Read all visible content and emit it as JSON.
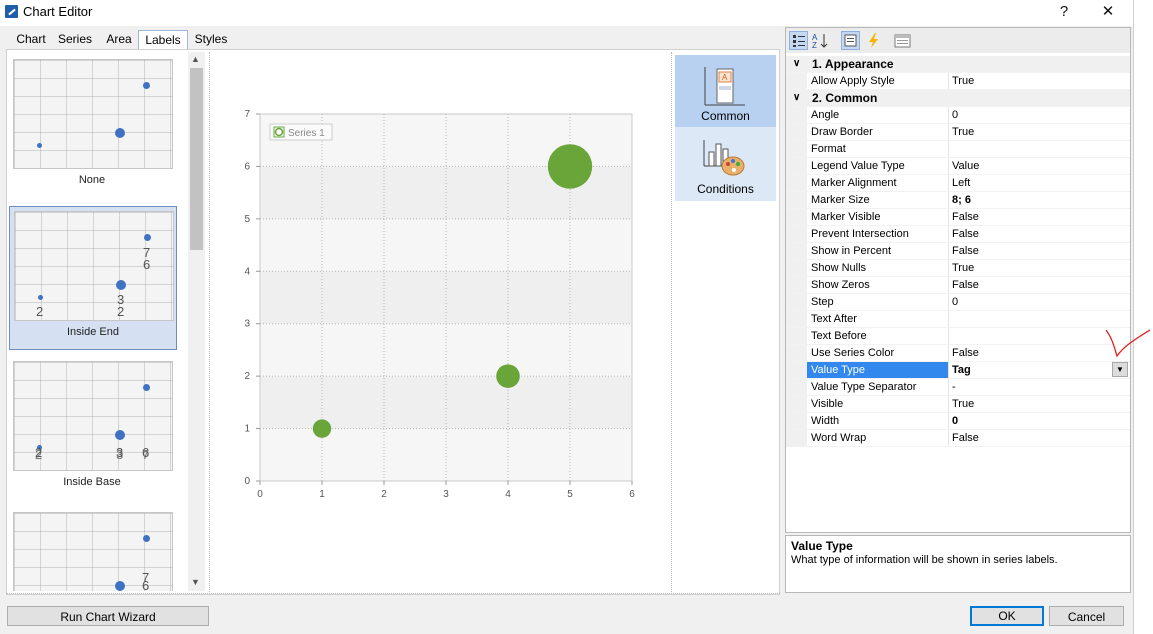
{
  "window": {
    "title": "Chart Editor",
    "help_label": "?",
    "close_label": "✕"
  },
  "tabs": [
    {
      "label": "Chart"
    },
    {
      "label": "Series"
    },
    {
      "label": "Area"
    },
    {
      "label": "Labels",
      "active": true
    },
    {
      "label": "Styles"
    }
  ],
  "thumbnails": [
    {
      "label": "None"
    },
    {
      "label": "Inside End",
      "selected": true,
      "tags": [
        "7",
        "6",
        "3",
        "2",
        "2"
      ]
    },
    {
      "label": "Inside Base",
      "tags": [
        "2",
        "2",
        "3",
        "3",
        "6",
        "7"
      ]
    },
    {
      "label": "",
      "tags": [
        "7",
        "6"
      ]
    }
  ],
  "chart_data": {
    "type": "scatter",
    "legend": "Series 1",
    "legend_placement": "top-left",
    "x_ticks": [
      "0",
      "1",
      "2",
      "3",
      "4",
      "5",
      "6"
    ],
    "y_ticks": [
      "0",
      "1",
      "2",
      "3",
      "4",
      "5",
      "6",
      "7"
    ],
    "xlim": [
      0,
      6
    ],
    "ylim": [
      0,
      7
    ],
    "grid": true,
    "series": [
      {
        "color": "#6aa53a",
        "points": [
          {
            "x": 1,
            "y": 1,
            "weight": 2
          },
          {
            "x": 4,
            "y": 2,
            "weight": 3
          },
          {
            "x": 5,
            "y": 6,
            "weight": 7
          }
        ]
      }
    ]
  },
  "side_buttons": [
    {
      "label": "Common",
      "icon": "common-layout-icon",
      "active": true
    },
    {
      "label": "Conditions",
      "icon": "conditions-chart-icon"
    }
  ],
  "property_grid": {
    "categories": [
      {
        "label": "1. Appearance",
        "rows": [
          {
            "name": "Allow Apply Style",
            "value": "True"
          }
        ]
      },
      {
        "label": "2. Common",
        "rows": [
          {
            "name": "Angle",
            "value": "0"
          },
          {
            "name": "Draw Border",
            "value": "True"
          },
          {
            "name": "Format",
            "value": ""
          },
          {
            "name": "Legend Value Type",
            "value": "Value"
          },
          {
            "name": "Marker Alignment",
            "value": "Left"
          },
          {
            "name": "Marker Size",
            "value": "8; 6",
            "bold": true
          },
          {
            "name": "Marker Visible",
            "value": "False"
          },
          {
            "name": "Prevent Intersection",
            "value": "False"
          },
          {
            "name": "Show in Percent",
            "value": "False"
          },
          {
            "name": "Show Nulls",
            "value": "True"
          },
          {
            "name": "Show Zeros",
            "value": "False"
          },
          {
            "name": "Step",
            "value": "0"
          },
          {
            "name": "Text After",
            "value": ""
          },
          {
            "name": "Text Before",
            "value": ""
          },
          {
            "name": "Use Series Color",
            "value": "False"
          },
          {
            "name": "Value Type",
            "value": "Tag",
            "bold": true,
            "selected": true
          },
          {
            "name": "Value Type Separator",
            "value": "-"
          },
          {
            "name": "Visible",
            "value": "True"
          },
          {
            "name": "Width",
            "value": "0",
            "bold": true
          },
          {
            "name": "Word Wrap",
            "value": "False"
          }
        ]
      }
    ]
  },
  "description": {
    "title": "Value Type",
    "text": "What type of information will be shown in series labels."
  },
  "footer": {
    "wizard_label": "Run Chart Wizard",
    "ok_label": "OK",
    "cancel_label": "Cancel"
  }
}
